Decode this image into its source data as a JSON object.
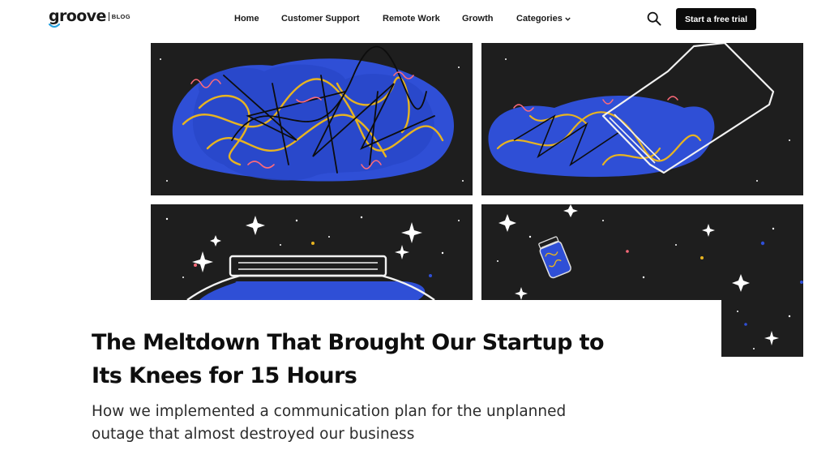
{
  "logo": {
    "wordmark": "groove",
    "label": "BLOG"
  },
  "nav": {
    "items": [
      {
        "label": "Home"
      },
      {
        "label": "Customer Support"
      },
      {
        "label": "Remote Work"
      },
      {
        "label": "Growth"
      },
      {
        "label": "Categories"
      }
    ]
  },
  "cta": {
    "label": "Start a free trial"
  },
  "article": {
    "title_line1": "The Meltdown That Brought Our Startup to",
    "title_line2": "Its Knees for 15 Hours",
    "subtitle_line1": "How we implemented a communication plan for the unplanned",
    "subtitle_line2": "outage that almost destroyed our business"
  },
  "icons": {
    "search": "search-icon",
    "categories": "chevron-down-icon"
  },
  "colors": {
    "panel": "#1e1e1e",
    "scribble_blue": "#2f4fd6",
    "scribble_yellow": "#e8b420",
    "scribble_pink": "#ff6b7a",
    "cta_bg": "#0b0b0b"
  }
}
